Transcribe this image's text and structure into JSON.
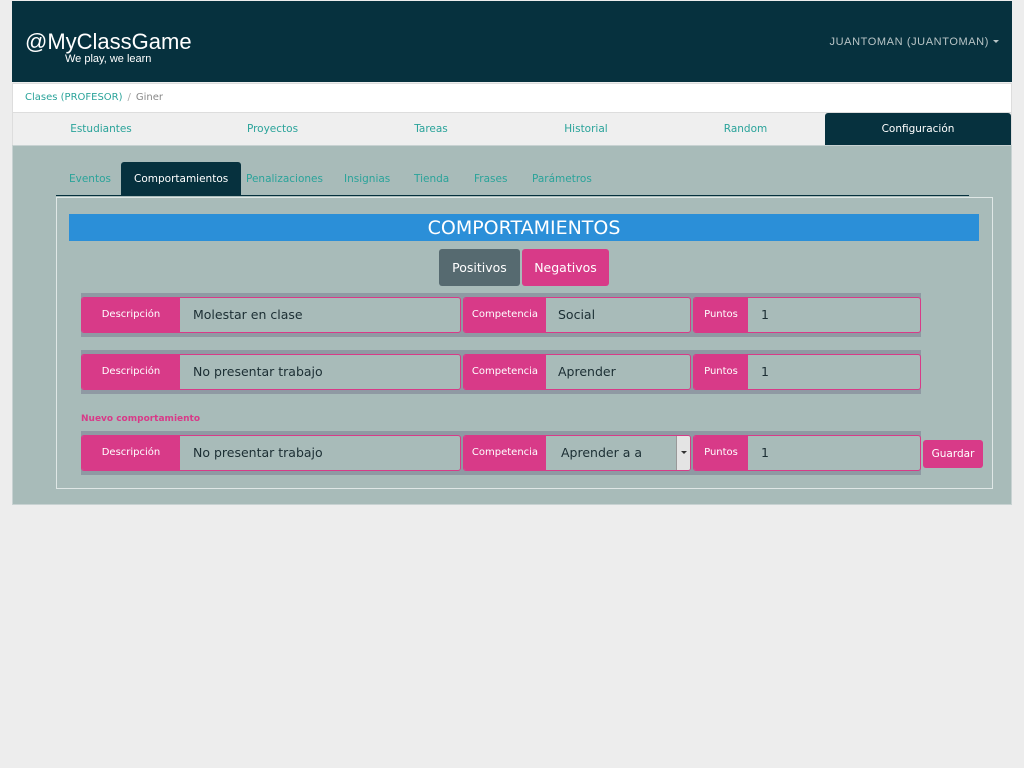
{
  "header": {
    "brand": "@MyClassGame",
    "tagline": "We play, we learn",
    "user": "JUANTOMAN (JUANTOMAN)"
  },
  "breadcrumb": {
    "items": [
      "Clases (PROFESOR)",
      "Giner"
    ],
    "separator": "/"
  },
  "main_nav": {
    "items": [
      "Estudiantes",
      "Proyectos",
      "Tareas",
      "Historial",
      "Random",
      "Configuración"
    ],
    "active": "Configuración"
  },
  "subtabs": {
    "items": [
      "Eventos",
      "Comportamientos",
      "Penalizaciones",
      "Insignias",
      "Tienda",
      "Frases",
      "Parámetros"
    ],
    "active": "Comportamientos"
  },
  "section": {
    "title": "COMPORTAMIENTOS",
    "toggle_positive": "Positivos",
    "toggle_negative": "Negativos"
  },
  "labels": {
    "description": "Descripción",
    "competence": "Competencia",
    "points": "Puntos"
  },
  "behaviors": [
    {
      "description": "Molestar en clase",
      "competence": "Social",
      "points": "1"
    },
    {
      "description": "No presentar trabajo",
      "competence": "Aprender",
      "points": "1"
    }
  ],
  "new_behavior": {
    "label": "Nuevo comportamiento",
    "description": "No presentar trabajo",
    "competence": "Aprender a aprender",
    "points": "1",
    "save_label": "Guardar"
  },
  "colors": {
    "header_bg": "#06313e",
    "accent_pink": "#d83a88",
    "accent_blue": "#2b8fd8",
    "link_teal": "#2aa39a",
    "content_bg": "#a8bbb9"
  }
}
